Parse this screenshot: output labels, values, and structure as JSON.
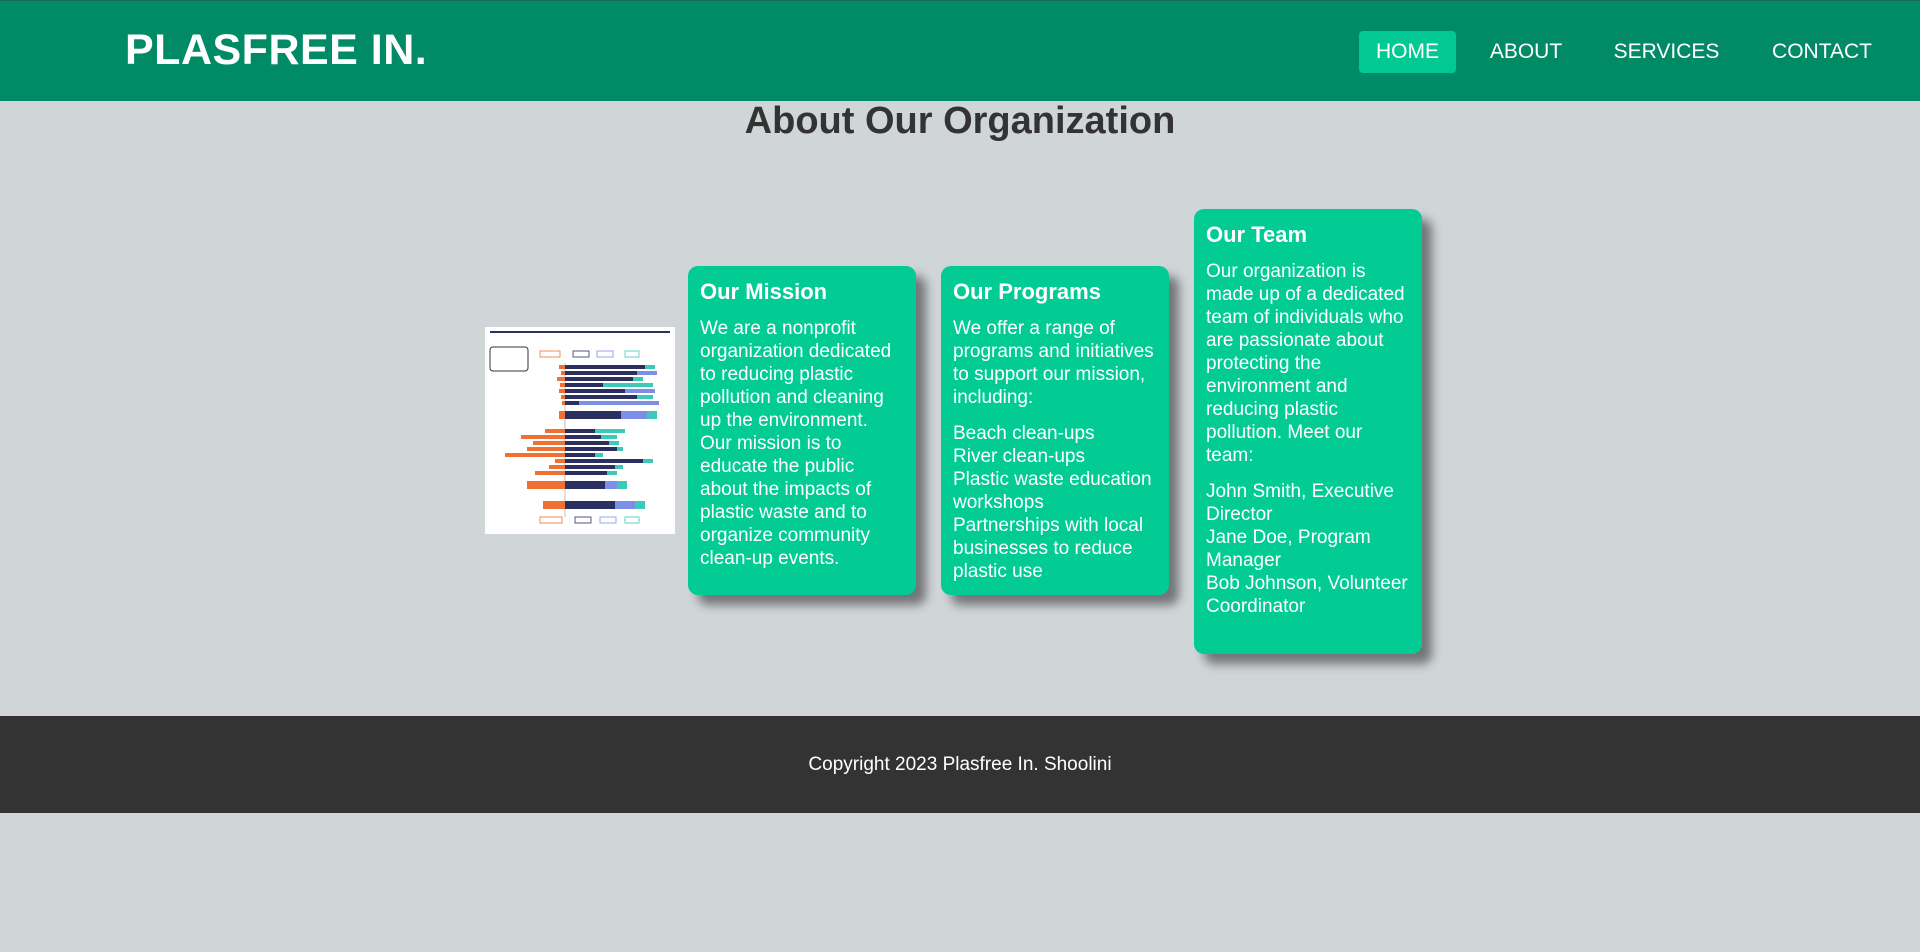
{
  "header": {
    "logo": "PLASFREE IN.",
    "nav": [
      {
        "label": "HOME",
        "active": true
      },
      {
        "label": "ABOUT",
        "active": false
      },
      {
        "label": "SERVICES",
        "active": false
      },
      {
        "label": "CONTACT",
        "active": false
      }
    ]
  },
  "page_title": "About Our Organization",
  "cards": [
    {
      "title": "Our Mission",
      "text": "We are a nonprofit organization dedicated to reducing plastic pollution and cleaning up the environment. Our mission is to educate the public about the impacts of plastic waste and to organize community clean-up events.",
      "items": []
    },
    {
      "title": "Our Programs",
      "text": "We offer a range of programs and initiatives to support our mission, including:",
      "items": [
        "Beach clean-ups",
        "River clean-ups",
        "Plastic waste education workshops",
        "Partnerships with local businesses to reduce plastic use"
      ]
    },
    {
      "title": "Our Team",
      "text": "Our organization is made up of a dedicated team of individuals who are passionate about protecting the environment and reducing plastic pollution. Meet our team:",
      "items": [
        "John Smith, Executive Director",
        "Jane Doe, Program Manager",
        "Bob Johnson, Volunteer Coordinator"
      ]
    }
  ],
  "footer": {
    "copyright": "Copyright 2023 Plasfree In. Shoolini"
  },
  "colors": {
    "header_bg": "#008a65",
    "accent": "#02cc94",
    "page_bg": "#d0d5d8",
    "footer_bg": "#333333"
  }
}
